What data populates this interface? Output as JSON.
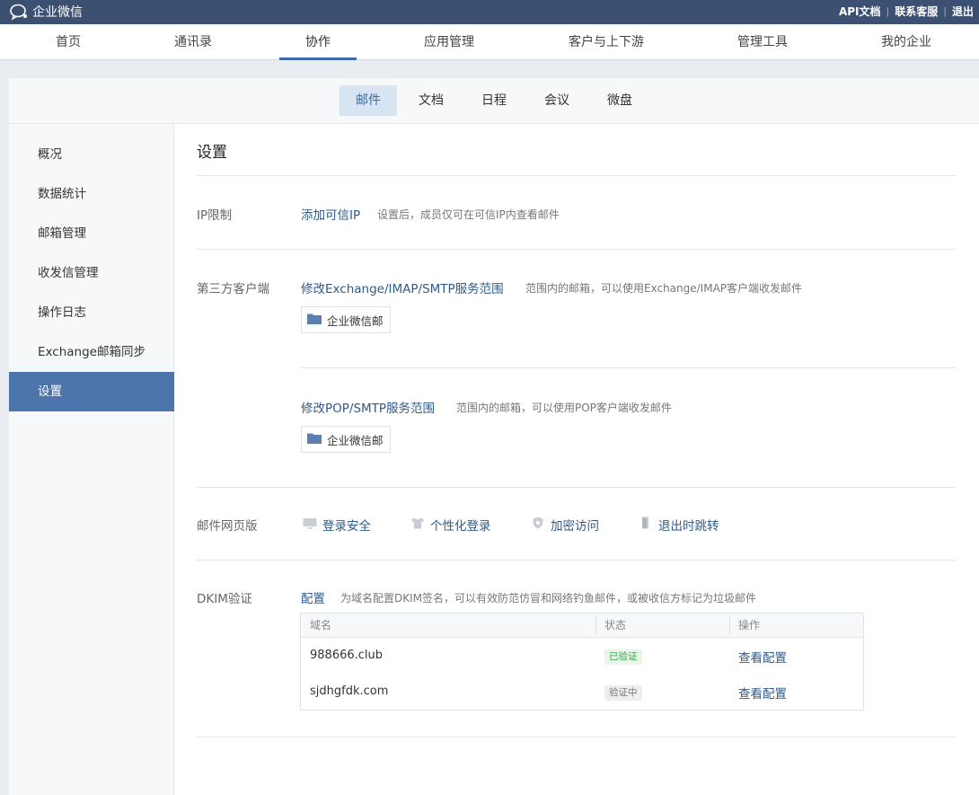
{
  "topbar": {
    "brand": "企业微信",
    "links": [
      "API文档",
      "联系客服",
      "退出"
    ]
  },
  "main_nav": {
    "items": [
      "首页",
      "通讯录",
      "协作",
      "应用管理",
      "客户与上下游",
      "管理工具",
      "我的企业"
    ],
    "active": "协作"
  },
  "sub_nav": {
    "items": [
      "邮件",
      "文档",
      "日程",
      "会议",
      "微盘"
    ],
    "active": "邮件"
  },
  "sidebar": {
    "items": [
      "概况",
      "数据统计",
      "邮箱管理",
      "收发信管理",
      "操作日志",
      "Exchange邮箱同步",
      "设置"
    ],
    "active": "设置"
  },
  "panel": {
    "title": "设置",
    "ip_limit": {
      "label": "IP限制",
      "link": "添加可信IP",
      "desc": "设置后，成员仅可在可信IP内查看邮件"
    },
    "third_party": {
      "label": "第三方客户端",
      "exchange_link": "修改Exchange/IMAP/SMTP服务范围",
      "exchange_desc": "范围内的邮箱，可以使用Exchange/IMAP客户端收发邮件",
      "exchange_chip": "企业微信邮",
      "pop_link": "修改POP/SMTP服务范围",
      "pop_desc": "范围内的邮箱，可以使用POP客户端收发邮件",
      "pop_chip": "企业微信邮"
    },
    "web_mail": {
      "label": "邮件网页版",
      "options": [
        {
          "label": "登录安全",
          "icon": "monitor-icon"
        },
        {
          "label": "个性化登录",
          "icon": "shirt-icon"
        },
        {
          "label": "加密访问",
          "icon": "shield-icon"
        },
        {
          "label": "退出时跳转",
          "icon": "door-icon"
        }
      ]
    },
    "dkim": {
      "label": "DKIM验证",
      "link": "配置",
      "desc": "为域名配置DKIM签名，可以有效防范仿冒和网络钓鱼邮件，或被收信方标记为垃圾邮件",
      "columns": [
        "域名",
        "状态",
        "操作"
      ],
      "rows": [
        {
          "domain": "988666.club",
          "status": "已验证",
          "action": "查看配置"
        },
        {
          "domain": "sjdhgfdk.com",
          "status": "验证中",
          "action": "查看配置"
        }
      ]
    }
  },
  "colors": {
    "topbar": "#3c5171",
    "accent": "#3c6aa8",
    "sidebar_active": "#4c75ab",
    "link": "#2f5a8c",
    "verified": "#3aa14b"
  }
}
